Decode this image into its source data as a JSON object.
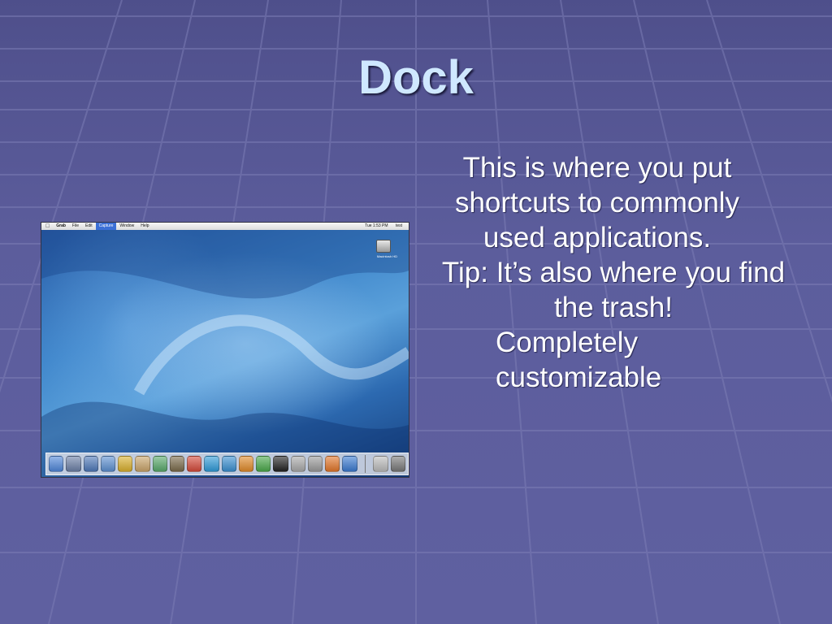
{
  "slide": {
    "title": "Dock",
    "bullets": [
      "This is where you put shortcuts to commonly used applications.",
      "Tip:  It’s also where you find the trash!",
      "Completely customizable"
    ]
  },
  "screenshot": {
    "menubar": {
      "apple": "",
      "app": "Grab",
      "items": [
        "File",
        "Edit",
        "Capture",
        "Window",
        "Help"
      ],
      "clock": "Tue 1:53 PM",
      "user": "test"
    },
    "desktop_icon_label": "Macintosh HD",
    "dock_icons": [
      {
        "name": "finder-icon",
        "color": "#4f86d9"
      },
      {
        "name": "dashboard-icon",
        "color": "#6b7fa6"
      },
      {
        "name": "mail-icon",
        "color": "#4e78b8"
      },
      {
        "name": "safari-icon",
        "color": "#5c8fd0"
      },
      {
        "name": "ichat-icon",
        "color": "#d9b02e"
      },
      {
        "name": "address-book-icon",
        "color": "#c9a46a"
      },
      {
        "name": "itunes-icon",
        "color": "#58a86a"
      },
      {
        "name": "iphoto-icon",
        "color": "#7a6a4a"
      },
      {
        "name": "ical-icon",
        "color": "#d44a3a"
      },
      {
        "name": "app-q-icon",
        "color": "#2f9ad8"
      },
      {
        "name": "app-u-icon",
        "color": "#3a8fd0"
      },
      {
        "name": "app-p-icon",
        "color": "#e08a2a"
      },
      {
        "name": "app-x-icon",
        "color": "#4aa84a"
      },
      {
        "name": "terminal-icon",
        "color": "#222222"
      },
      {
        "name": "preview-icon",
        "color": "#a8a8a8"
      },
      {
        "name": "photo-icon",
        "color": "#9a9a9a"
      },
      {
        "name": "firefox-icon",
        "color": "#e2762a"
      },
      {
        "name": "internet-explorer-icon",
        "color": "#3a7ad0"
      }
    ],
    "dock_right_icons": [
      {
        "name": "downloads-icon",
        "color": "#bbbbbb"
      },
      {
        "name": "trash-icon",
        "color": "#777777"
      }
    ]
  }
}
